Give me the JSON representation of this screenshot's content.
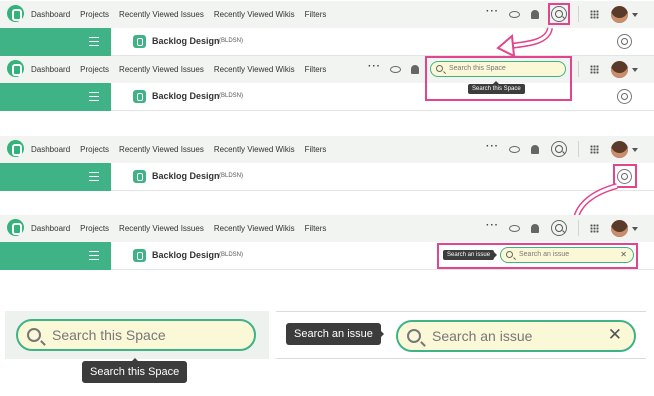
{
  "nav": {
    "dashboard": "Dashboard",
    "projects": "Projects",
    "recent_issues": "Recently Viewed Issues",
    "recent_wikis": "Recently Viewed Wikis",
    "filters": "Filters"
  },
  "project": {
    "name": "Backlog Design",
    "key": "(BLDSN)"
  },
  "search_space": {
    "placeholder": "Search this Space",
    "tooltip": "Search this Space"
  },
  "search_issue": {
    "placeholder": "Search an issue",
    "tooltip": "Search an issue"
  },
  "icons": {
    "logo": "backlog-logo-icon",
    "more": "more-dots-icon",
    "watch": "eye-icon",
    "notifications": "bell-icon",
    "search": "search-icon",
    "apps": "grid-icon",
    "menu": "hamburger-icon",
    "clear": "close-icon"
  },
  "colors": {
    "brand": "#3fb286",
    "highlight": "#e2448d",
    "field_bg": "#fbf8d8",
    "tooltip_bg": "#3c3c3c"
  }
}
